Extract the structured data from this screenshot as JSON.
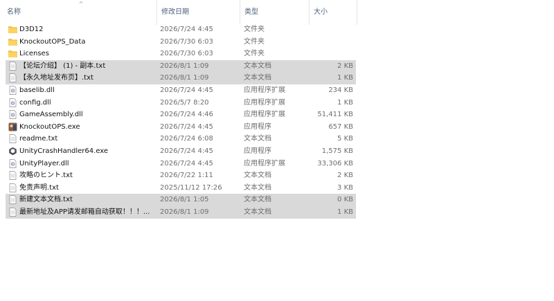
{
  "columns": {
    "name": "名称",
    "date": "修改日期",
    "type": "类型",
    "size": "大小",
    "sort_indicator": "^"
  },
  "files": [
    {
      "name": "D3D12",
      "date": "2026/7/24 4:45",
      "type": "文件夹",
      "size": "",
      "icon": "folder-icon",
      "selected": false
    },
    {
      "name": "KnockoutOPS_Data",
      "date": "2026/7/30 6:03",
      "type": "文件夹",
      "size": "",
      "icon": "folder-icon",
      "selected": false
    },
    {
      "name": "Licenses",
      "date": "2026/7/30 6:03",
      "type": "文件夹",
      "size": "",
      "icon": "folder-icon",
      "selected": false
    },
    {
      "name": "【论坛介绍】 (1) - 副本.txt",
      "date": "2026/8/1 1:09",
      "type": "文本文档",
      "size": "2 KB",
      "icon": "text-file-icon",
      "selected": true
    },
    {
      "name": "【永久地址发布页】.txt",
      "date": "2026/8/1 1:09",
      "type": "文本文档",
      "size": "1 KB",
      "icon": "text-file-icon",
      "selected": true
    },
    {
      "name": "baselib.dll",
      "date": "2026/7/24 4:45",
      "type": "应用程序扩展",
      "size": "234 KB",
      "icon": "dll-file-icon",
      "selected": false
    },
    {
      "name": "config.dll",
      "date": "2026/5/7 8:20",
      "type": "应用程序扩展",
      "size": "1 KB",
      "icon": "dll-file-icon",
      "selected": false
    },
    {
      "name": "GameAssembly.dll",
      "date": "2026/7/24 4:46",
      "type": "应用程序扩展",
      "size": "51,411 KB",
      "icon": "dll-file-icon",
      "selected": false
    },
    {
      "name": "KnockoutOPS.exe",
      "date": "2026/7/24 4:45",
      "type": "应用程序",
      "size": "657 KB",
      "icon": "game-app-icon",
      "selected": false
    },
    {
      "name": "readme.txt",
      "date": "2026/7/24 6:08",
      "type": "文本文档",
      "size": "5 KB",
      "icon": "text-file-icon",
      "selected": false
    },
    {
      "name": "UnityCrashHandler64.exe",
      "date": "2026/7/24 4:45",
      "type": "应用程序",
      "size": "1,575 KB",
      "icon": "unity-app-icon",
      "selected": false
    },
    {
      "name": "UnityPlayer.dll",
      "date": "2026/7/24 4:45",
      "type": "应用程序扩展",
      "size": "33,306 KB",
      "icon": "dll-file-icon",
      "selected": false
    },
    {
      "name": "攻略のヒント.txt",
      "date": "2026/7/22 1:11",
      "type": "文本文档",
      "size": "2 KB",
      "icon": "text-file-icon",
      "selected": false
    },
    {
      "name": "免责声明.txt",
      "date": "2025/11/12 17:26",
      "type": "文本文档",
      "size": "3 KB",
      "icon": "text-file-icon",
      "selected": false
    },
    {
      "name": "新建文本文档.txt",
      "date": "2026/8/1 1:05",
      "type": "文本文档",
      "size": "0 KB",
      "icon": "text-file-icon",
      "selected": true
    },
    {
      "name": "最新地址及APP请发邮箱自动获取！！！...",
      "date": "2026/8/1 1:09",
      "type": "文本文档",
      "size": "1 KB",
      "icon": "text-file-icon",
      "selected": true
    }
  ],
  "colors": {
    "folder": "#f5c242",
    "selection": "#d9d9d9",
    "header_text": "#4c607a",
    "secondary_text": "#6d6d6d"
  }
}
